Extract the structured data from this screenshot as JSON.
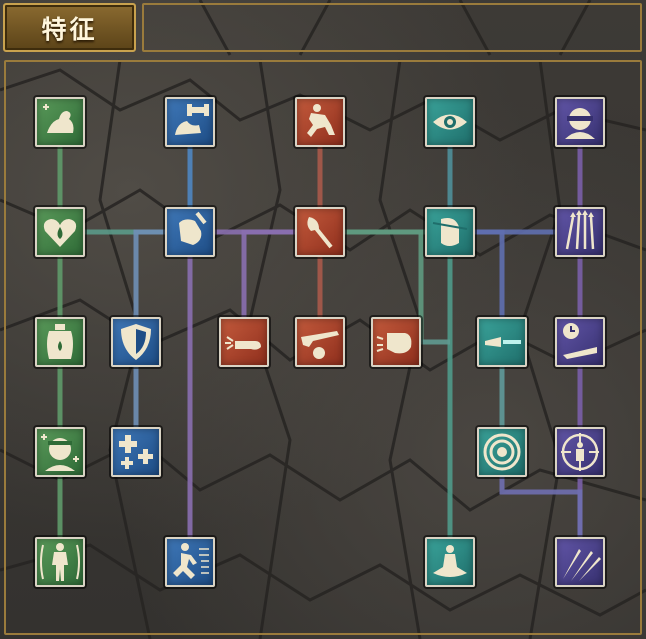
{
  "header": {
    "title": "特征"
  },
  "colors": {
    "green": "#4f8f55",
    "blue": "#3f7fc0",
    "red": "#b84a34",
    "teal": "#2f8f8a",
    "purple": "#54489a",
    "gold_frame": "#9a7b3c"
  },
  "traits": [
    {
      "id": "strength",
      "icon": "flexing-arm-icon",
      "color": "green"
    },
    {
      "id": "dumbbell",
      "icon": "dumbbell-arm-icon",
      "color": "blue"
    },
    {
      "id": "sneak",
      "icon": "sneaking-man-icon",
      "color": "red"
    },
    {
      "id": "perception",
      "icon": "eye-icon",
      "color": "teal"
    },
    {
      "id": "blind-focus",
      "icon": "blindfold-head-icon",
      "color": "purple"
    },
    {
      "id": "health",
      "icon": "heart-drop-icon",
      "color": "green"
    },
    {
      "id": "grip",
      "icon": "fist-grip-icon",
      "color": "blue"
    },
    {
      "id": "axe",
      "icon": "hand-axe-icon",
      "color": "red"
    },
    {
      "id": "pain",
      "icon": "pierced-head-icon",
      "color": "teal"
    },
    {
      "id": "arrows",
      "icon": "arrows-icon",
      "color": "purple"
    },
    {
      "id": "canteen",
      "icon": "canteen-icon",
      "color": "green"
    },
    {
      "id": "shield",
      "icon": "shield-icon",
      "color": "blue"
    },
    {
      "id": "slap",
      "icon": "hand-strike-icon",
      "color": "red"
    },
    {
      "id": "rifle",
      "icon": "rifle-icon",
      "color": "red"
    },
    {
      "id": "punch",
      "icon": "fist-punch-icon",
      "color": "red"
    },
    {
      "id": "blast",
      "icon": "blast-icon",
      "color": "teal"
    },
    {
      "id": "timer",
      "icon": "clock-hand-icon",
      "color": "purple"
    },
    {
      "id": "healing",
      "icon": "bandaged-head-icon",
      "color": "green"
    },
    {
      "id": "medkit",
      "icon": "medical-crosses-icon",
      "color": "blue"
    },
    {
      "id": "target",
      "icon": "target-icon",
      "color": "teal"
    },
    {
      "id": "scope",
      "icon": "crosshair-body-icon",
      "color": "purple"
    },
    {
      "id": "anatomy",
      "icon": "human-body-icon",
      "color": "green"
    },
    {
      "id": "sprint",
      "icon": "running-man-icon",
      "color": "blue"
    },
    {
      "id": "meditation",
      "icon": "meditation-icon",
      "color": "teal"
    },
    {
      "id": "knives",
      "icon": "throwing-knives-icon",
      "color": "purple"
    }
  ]
}
